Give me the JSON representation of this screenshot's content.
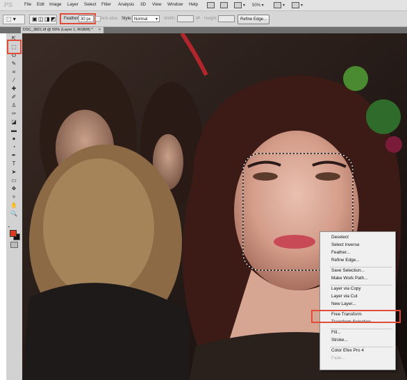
{
  "app": {
    "logo": "PS"
  },
  "menubar": {
    "items": [
      "File",
      "Edit",
      "Image",
      "Layer",
      "Select",
      "Filter",
      "Analysis",
      "3D",
      "View",
      "Window",
      "Help"
    ],
    "zoom": "50%"
  },
  "options": {
    "feather_label": "Feather:",
    "feather_value": "30 px",
    "antialias_label": "Anti-alias",
    "style_label": "Style:",
    "style_value": "Normal",
    "width_label": "Width:",
    "height_label": "Height:",
    "refine_edge_label": "Refine Edge..."
  },
  "document": {
    "tab_title": "DSC_3821.tif @ 50% (Layer 1, RGB/8) *",
    "close_glyph": "×"
  },
  "tools": [
    {
      "name": "move-tool-icon",
      "glyph": "⇱"
    },
    {
      "name": "rectangular-marquee-tool-icon",
      "glyph": "⬚"
    },
    {
      "name": "lasso-tool-icon",
      "glyph": "ʘ"
    },
    {
      "name": "quick-selection-tool-icon",
      "glyph": "✎"
    },
    {
      "name": "crop-tool-icon",
      "glyph": "⌗"
    },
    {
      "name": "eyedropper-tool-icon",
      "glyph": "⁄"
    },
    {
      "name": "spot-healing-tool-icon",
      "glyph": "✚"
    },
    {
      "name": "brush-tool-icon",
      "glyph": "✐"
    },
    {
      "name": "clone-stamp-tool-icon",
      "glyph": "♙"
    },
    {
      "name": "history-brush-tool-icon",
      "glyph": "✑"
    },
    {
      "name": "eraser-tool-icon",
      "glyph": "◪"
    },
    {
      "name": "gradient-tool-icon",
      "glyph": "▬"
    },
    {
      "name": "blur-tool-icon",
      "glyph": "●"
    },
    {
      "name": "dodge-tool-icon",
      "glyph": "◔"
    },
    {
      "name": "pen-tool-icon",
      "glyph": "✒"
    },
    {
      "name": "type-tool-icon",
      "glyph": "T"
    },
    {
      "name": "path-selection-tool-icon",
      "glyph": "➤"
    },
    {
      "name": "rectangle-shape-tool-icon",
      "glyph": "▭"
    },
    {
      "name": "3d-rotate-tool-icon",
      "glyph": "❖"
    },
    {
      "name": "3d-orbit-tool-icon",
      "glyph": "✧"
    },
    {
      "name": "hand-tool-icon",
      "glyph": "✋"
    },
    {
      "name": "zoom-tool-icon",
      "glyph": "🔍"
    }
  ],
  "context_menu": {
    "items": [
      {
        "label": "Deselect",
        "enabled": true
      },
      {
        "label": "Select Inverse",
        "enabled": true
      },
      {
        "label": "Feather...",
        "enabled": true
      },
      {
        "label": "Refine Edge...",
        "enabled": true
      },
      {
        "sep": true
      },
      {
        "label": "Save Selection...",
        "enabled": true
      },
      {
        "label": "Make Work Path...",
        "enabled": true
      },
      {
        "sep": true
      },
      {
        "label": "Layer via Copy",
        "enabled": true
      },
      {
        "label": "Layer via Cut",
        "enabled": true
      },
      {
        "label": "New Layer...",
        "enabled": true
      },
      {
        "sep": true
      },
      {
        "label": "Free Transform",
        "enabled": true,
        "highlighted": true
      },
      {
        "label": "Transform Selection",
        "enabled": true
      },
      {
        "sep": true
      },
      {
        "label": "Fill...",
        "enabled": true
      },
      {
        "label": "Stroke...",
        "enabled": true
      },
      {
        "sep": true
      },
      {
        "label": "Color Efex Pro 4",
        "enabled": true
      },
      {
        "label": "Fade...",
        "enabled": false
      }
    ]
  },
  "colors": {
    "highlight_box": "#e04b3a",
    "foreground_swatch": "#e03a1e",
    "background_swatch": "#111111"
  }
}
